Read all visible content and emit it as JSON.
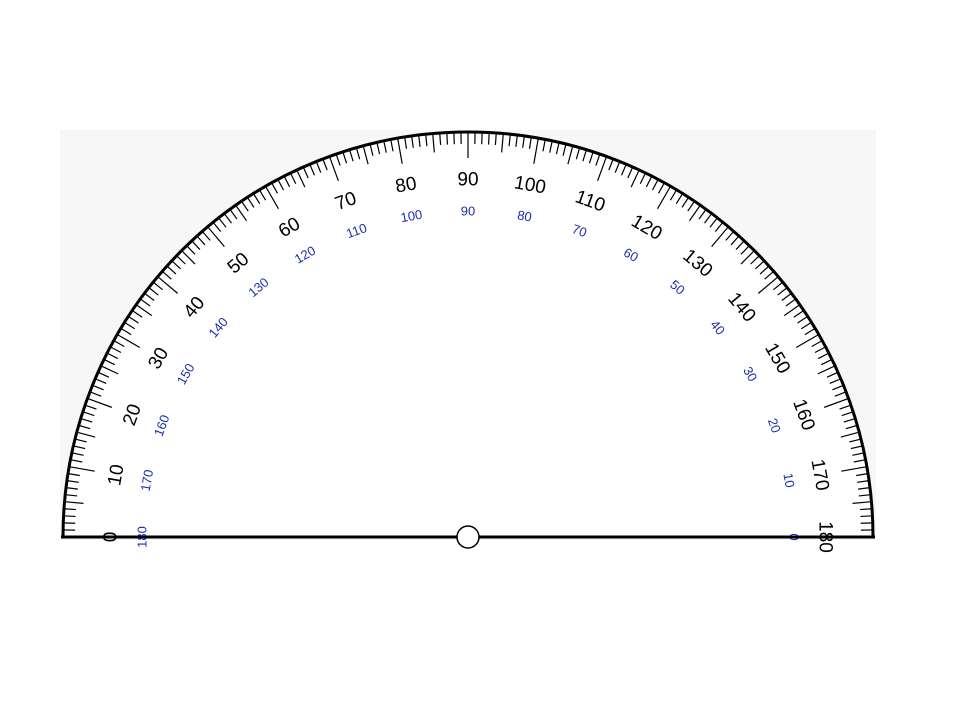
{
  "protractor": {
    "range_degrees": [
      0,
      180
    ],
    "outer_scale": {
      "direction": "counterclockwise from left",
      "labels": [
        "0",
        "10",
        "20",
        "30",
        "40",
        "50",
        "60",
        "70",
        "80",
        "90",
        "100",
        "110",
        "120",
        "130",
        "140",
        "150",
        "160",
        "170",
        "180"
      ]
    },
    "inner_scale": {
      "direction": "clockwise from left",
      "labels": [
        "180",
        "170",
        "160",
        "150",
        "140",
        "130",
        "120",
        "110",
        "100",
        "90",
        "80",
        "70",
        "60",
        "50",
        "40",
        "30",
        "20",
        "10",
        "0"
      ]
    },
    "tick_intervals_degrees": {
      "minor": 1,
      "medium": 5,
      "major": 10
    },
    "highlight_angles_degrees": [
      30,
      60,
      90,
      120,
      150
    ],
    "colors": {
      "outline": "#000000",
      "radial_major": "#000000",
      "radial_minor": "#9a9a9a",
      "highlight": "#8b1a1a",
      "inner_label": "#1a2fb0",
      "outer_label": "#000000",
      "backdrop": "#f7f7f7"
    }
  }
}
